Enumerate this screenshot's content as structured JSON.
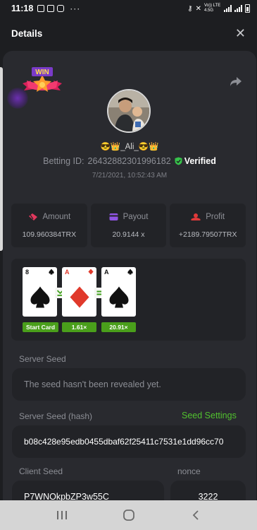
{
  "status_bar": {
    "time": "11:18",
    "dots": "···",
    "net_label": "Vo)) LTE 4.5G"
  },
  "header": {
    "title": "Details",
    "close_glyph": "✕"
  },
  "bet": {
    "username": "😎👑_Ali_😎👑",
    "betting_id_label": "Betting ID:",
    "betting_id": "26432882301996182",
    "verified_label": "Verified",
    "datetime": "7/21/2021, 10:52:43 AM"
  },
  "stats": [
    {
      "label": "Amount",
      "value": "109.960384TRX",
      "icon": "amount-icon",
      "color": "#e2385d"
    },
    {
      "label": "Payout",
      "value": "20.9144 x",
      "icon": "payout-icon",
      "color": "#9054e4"
    },
    {
      "label": "Profit",
      "value": "+2189.79507TRX",
      "icon": "profit-icon",
      "color": "#e03a3a"
    }
  ],
  "cards": [
    {
      "rank": "8",
      "suit": "spade",
      "label": "Start Card"
    },
    {
      "rank": "A",
      "suit": "diamond",
      "label": "1.61×"
    },
    {
      "rank": "A",
      "suit": "spade",
      "label": "20.91×"
    }
  ],
  "seeds": {
    "server_seed_label": "Server Seed",
    "server_seed_value": "The seed hasn't been revealed yet.",
    "server_hash_label": "Server Seed (hash)",
    "seed_settings_link": "Seed Settings",
    "server_hash_value": "b08c428e95edb0455dbaf62f25411c7531e1dd96cc70",
    "client_seed_label": "Client Seed",
    "client_seed_value": "P7WNOkpbZP3w55C",
    "nonce_label": "nonce",
    "nonce_value": "3222"
  },
  "colors": {
    "accent_green": "#51c12f",
    "verified_green": "#37c24b",
    "background": "#1d1e21",
    "panel": "#292a2f"
  }
}
